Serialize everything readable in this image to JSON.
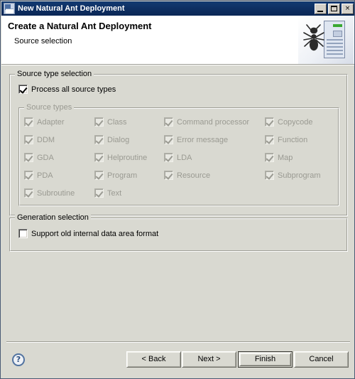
{
  "window": {
    "title": "New Natural Ant Deployment",
    "icon": "natural-ant-icon",
    "caption_buttons": [
      {
        "name": "minimize",
        "label": ""
      },
      {
        "name": "maximize",
        "label": ""
      },
      {
        "name": "close",
        "label": "×"
      }
    ],
    "titlebar_color": "#0e2f62",
    "face_color": "#d9d9d1"
  },
  "header": {
    "title": "Create a Natural Ant Deployment",
    "subtitle": "Source selection",
    "graphic": "ant-on-document-banner"
  },
  "source_type_selection": {
    "legend": "Source type selection",
    "process_all": {
      "label": "Process all source types",
      "checked": true,
      "enabled": true
    },
    "source_types_group": {
      "legend": "Source types",
      "enabled": false,
      "columns": [
        [
          {
            "label": "Adapter",
            "checked": true
          },
          {
            "label": "DDM",
            "checked": true
          },
          {
            "label": "GDA",
            "checked": true
          },
          {
            "label": "PDA",
            "checked": true
          },
          {
            "label": "Subroutine",
            "checked": true
          }
        ],
        [
          {
            "label": "Class",
            "checked": true
          },
          {
            "label": "Dialog",
            "checked": true
          },
          {
            "label": "Helproutine",
            "checked": true
          },
          {
            "label": "Program",
            "checked": true
          },
          {
            "label": "Text",
            "checked": true
          }
        ],
        [
          {
            "label": "Command processor",
            "checked": true
          },
          {
            "label": "Error message",
            "checked": true
          },
          {
            "label": "LDA",
            "checked": true
          },
          {
            "label": "Resource",
            "checked": true
          }
        ],
        [
          {
            "label": "Copycode",
            "checked": true
          },
          {
            "label": "Function",
            "checked": true
          },
          {
            "label": "Map",
            "checked": true
          },
          {
            "label": "Subprogram",
            "checked": true
          }
        ]
      ]
    }
  },
  "generation_selection": {
    "legend": "Generation selection",
    "support_old_format": {
      "label": "Support old internal data area format",
      "checked": false,
      "enabled": true
    }
  },
  "buttons": {
    "help": "?",
    "back": "< Back",
    "next": "Next >",
    "finish": "Finish",
    "cancel": "Cancel",
    "default_button": "Finish"
  }
}
